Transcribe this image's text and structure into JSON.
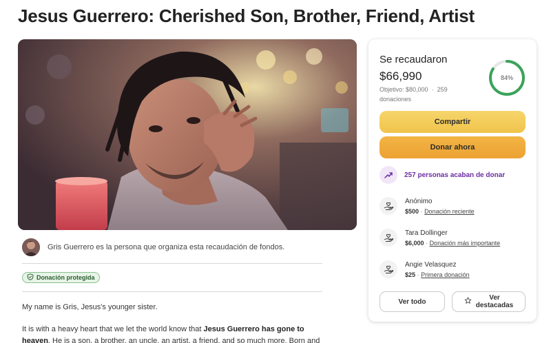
{
  "page": {
    "title": "Jesus Guerrero: Cherished Son, Brother, Friend, Artist"
  },
  "organizer": {
    "text": "Gris Guerrero es la persona que organiza esta recaudación de fondos."
  },
  "protected_badge": {
    "label": "Donación protegida",
    "icon": "shield-icon"
  },
  "story": {
    "p1": "My name is Gris, Jesus's younger sister.",
    "p2_start": "It is with a heavy heart that we let the world know that ",
    "p2_bold": "Jesus Guerrero has gone to heaven",
    "p2_end": ". He is a son, a brother, an uncle, an artist, a friend, and so much more. Born and"
  },
  "donation_card": {
    "raised_label": "Se recaudaron",
    "raised_amount": "$66,990",
    "goal": "Objetivo: $80,000",
    "donations_count": "259",
    "donations_label": "donaciones",
    "progress_label": "84%",
    "progress_fraction": 0.84,
    "share_label": "Compartir",
    "donate_label": "Donar ahora",
    "trend_text": "257 personas acaban de donar",
    "donors": [
      {
        "name": "Anónimo",
        "amount": "$500",
        "tag": "Donación reciente"
      },
      {
        "name": "Tara Dollinger",
        "amount": "$6,000",
        "tag": "Donación más importante"
      },
      {
        "name": "Angie Velasquez",
        "amount": "$25",
        "tag": "Primera donación"
      }
    ],
    "see_all_label": "Ver todo",
    "see_top_label_1": "Ver",
    "see_top_label_2": "destacadas"
  },
  "colors": {
    "share_button": "#f0c44a",
    "donate_button": "#eca233",
    "progress": "#3aa35a",
    "trend_text": "#6b2ea0",
    "badge_bg": "#e8f4e7"
  }
}
